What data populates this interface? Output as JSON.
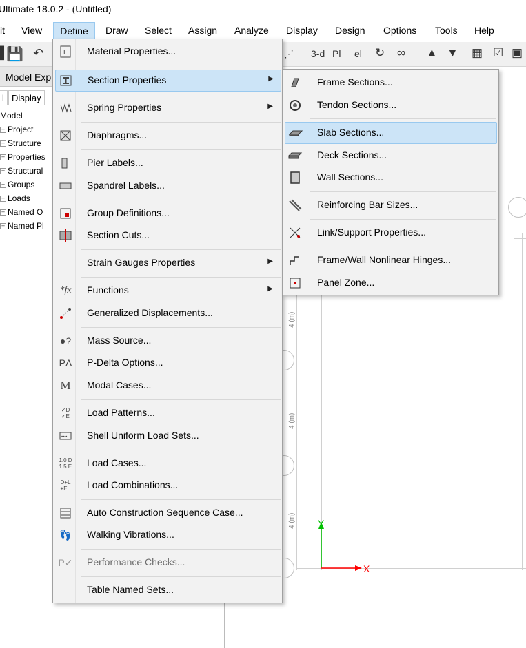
{
  "app": {
    "title": "Ultimate 18.0.2 - (Untitled)"
  },
  "menubar": {
    "items": [
      "it",
      "View",
      "Define",
      "Draw",
      "Select",
      "Assign",
      "Analyze",
      "Display",
      "Design",
      "Options",
      "Tools",
      "Help"
    ],
    "active": "Define"
  },
  "toolbar": {
    "view_label": "3-d"
  },
  "model_explorer": {
    "title": "Model Exp",
    "tabs": [
      "l",
      "Display"
    ],
    "tree_root": "Model",
    "tree_items": [
      "Project",
      "Structure",
      "Properties",
      "Structural",
      "Groups",
      "Loads",
      "Named O",
      "Named Pl"
    ]
  },
  "define_menu": {
    "items": [
      {
        "label": "Material Properties...",
        "icon": "material-icon"
      },
      {
        "label": "Section Properties",
        "icon": "section-icon",
        "submenu": true,
        "highlighted": true
      },
      {
        "label": "Spring Properties",
        "icon": "spring-icon",
        "submenu": true
      },
      {
        "label": "Diaphragms...",
        "icon": "diaphragm-icon"
      },
      {
        "label": "Pier Labels...",
        "icon": "pier-icon"
      },
      {
        "label": "Spandrel Labels...",
        "icon": "spandrel-icon"
      },
      {
        "label": "Group Definitions...",
        "icon": "group-icon"
      },
      {
        "label": "Section Cuts...",
        "icon": "section-cut-icon"
      },
      {
        "label": "Strain Gauges Properties",
        "icon": "",
        "submenu": true
      },
      {
        "label": "Functions",
        "icon": "function-icon",
        "submenu": true
      },
      {
        "label": "Generalized Displacements...",
        "icon": "displacement-icon"
      },
      {
        "label": "Mass Source...",
        "icon": "mass-icon"
      },
      {
        "label": "P-Delta Options...",
        "icon": "pdelta-icon"
      },
      {
        "label": "Modal Cases...",
        "icon": "modal-icon"
      },
      {
        "label": "Load Patterns...",
        "icon": "load-pattern-icon"
      },
      {
        "label": "Shell Uniform Load Sets...",
        "icon": "shell-load-icon"
      },
      {
        "label": "Load Cases...",
        "icon": "load-case-icon"
      },
      {
        "label": "Load Combinations...",
        "icon": "load-combo-icon"
      },
      {
        "label": "Auto Construction Sequence Case...",
        "icon": "construction-icon"
      },
      {
        "label": "Walking Vibrations...",
        "icon": "walking-icon"
      },
      {
        "label": "Performance Checks...",
        "icon": "performance-icon",
        "disabled": true
      },
      {
        "label": "Table Named Sets...",
        "icon": ""
      }
    ],
    "icon_text": {
      "function": "*fx",
      "pdelta": "PΔ",
      "modal": "M",
      "load_pattern": "✓D\n✓E",
      "load_case": "1.0 D\n1.5 E",
      "load_combo": "D+L\n+E"
    }
  },
  "section_submenu": {
    "items": [
      {
        "label": "Frame Sections...",
        "icon": "frame-section-icon"
      },
      {
        "label": "Tendon Sections...",
        "icon": "tendon-icon"
      },
      {
        "label": "Slab Sections...",
        "icon": "slab-icon",
        "highlighted": true
      },
      {
        "label": "Deck Sections...",
        "icon": "deck-icon"
      },
      {
        "label": "Wall Sections...",
        "icon": "wall-icon"
      },
      {
        "label": "Reinforcing Bar Sizes...",
        "icon": "rebar-icon"
      },
      {
        "label": "Link/Support Properties...",
        "icon": "link-icon"
      },
      {
        "label": "Frame/Wall Nonlinear Hinges...",
        "icon": "hinge-icon"
      },
      {
        "label": "Panel Zone...",
        "icon": "panel-zone-icon"
      }
    ]
  },
  "canvas": {
    "dimension_label": "4 (m)",
    "axis_x": "X",
    "axis_y": "Y",
    "axis_x_color": "#ff0000",
    "axis_y_color": "#00c000"
  },
  "colors": {
    "highlight": "#cce4f7",
    "highlight_border": "#99c9ef",
    "menu_bg": "#f2f2f2"
  }
}
